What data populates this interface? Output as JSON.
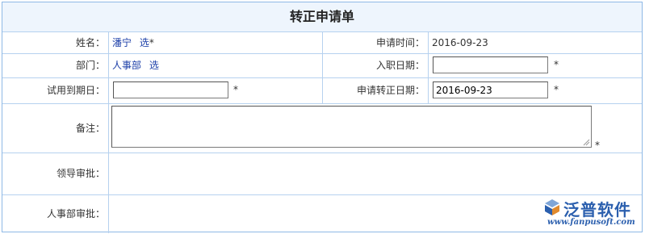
{
  "form": {
    "title": "转正申请单",
    "fields": {
      "name_label": "姓名：",
      "name_value": "潘宁",
      "name_select": "选",
      "name_required": "*",
      "apply_time_label": "申请时间：",
      "apply_time_value": "2016-09-23",
      "dept_label": "部门：",
      "dept_value": "人事部",
      "dept_select": "选",
      "entry_date_label": "入职日期：",
      "entry_date_value": "",
      "entry_date_required": "*",
      "trial_end_label": "试用到期日：",
      "trial_end_value": "",
      "trial_end_required": "*",
      "regular_date_label": "申请转正日期：",
      "regular_date_value": "2016-09-23",
      "regular_date_required": "*",
      "remark_label": "备注：",
      "remark_value": "",
      "remark_required": "*",
      "leader_approval_label": "领导审批：",
      "hr_approval_label": "人事部审批："
    }
  },
  "logo": {
    "text": "泛普软件",
    "url": "www.fanpusoft.com"
  }
}
